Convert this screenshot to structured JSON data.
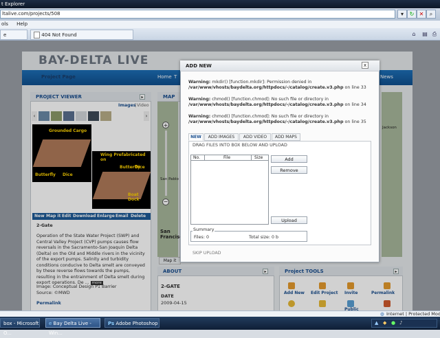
{
  "browser": {
    "title": "t Explorer",
    "address": "ltalive.com/projects/508",
    "menu": [
      "ols",
      "Help"
    ],
    "tabs": [
      "e",
      "404 Not Found"
    ]
  },
  "site": {
    "logo": "BAY-DELTA LIVE",
    "nav": [
      "Project Page",
      "Home",
      "T",
      "News"
    ],
    "viewer": {
      "header": "PROJECT VIEWER",
      "images_link": "Images",
      "video_link": "Video",
      "slide_labels": [
        "Grounded Cargo",
        "Wing Prefabricated on",
        "Butterfly",
        "Dice",
        "Boat Dock",
        "Butterfly",
        "Dice"
      ],
      "actions": [
        "New",
        "Map it",
        "Edit",
        "Download",
        "Enlarge",
        "Email",
        "Delete"
      ],
      "caption_title": "2-Gate",
      "caption": "Operation of the State Water Project (SWP) and Central Valley Project (CVP) pumps causes flow reversals in the Sacramento-San Joaquin Delta (Delta) on the Old and Middle rivers in the vicinity of the export pumps. Salinity and turbidity conditions conducive to Delta smelt are conveyed by these reverse flows towards the pumps, resulting in the entrainment of Delta smelt during export operations. De ...",
      "more": "more",
      "image_line": "Image: Conceptual Design P1 Barrier",
      "source_line": "Source: ©MWD",
      "permalink": "Permalink"
    },
    "map": {
      "header": "MAP",
      "labels": [
        "San Pablo B",
        "San Francisco",
        "Jackson"
      ],
      "map_it": "Map it"
    },
    "about": {
      "header": "ABOUT",
      "name": "2-GATE",
      "date_label": "DATE",
      "date": "2009-04-15"
    },
    "tools": {
      "header": "Project TOOLS",
      "items": [
        "Add New",
        "Edit Project",
        "Invite",
        "Permalink",
        "Public"
      ]
    }
  },
  "dialog": {
    "title": "ADD NEW",
    "close": "x",
    "warnings": [
      {
        "label": "Warning:",
        "text": "mkdir() [function.mkdir]: Permission denied in",
        "path": "/var/www/vhosts/baydelta.org/httpdocs/-/catalog/create.v3.php",
        "line": "on line 33"
      },
      {
        "label": "Warning:",
        "text": "chmod() [function.chmod]: No such file or directory in",
        "path": "/var/www/vhosts/baydelta.org/httpdocs/-/catalog/create.v3.php",
        "line": "on line 34"
      },
      {
        "label": "Warning:",
        "text": "chmod() [function.chmod]: No such file or directory in",
        "path": "/var/www/vhosts/baydelta.org/httpdocs/-/catalog/create.v3.php",
        "line": "on line 35"
      }
    ],
    "tabs": [
      "NEW",
      "ADD IMAGES",
      "ADD VIDEO",
      "ADD MAPS"
    ],
    "drag_text": "DRAG FILES INTO BOX BELOW AND UPLOAD",
    "columns": [
      "No.",
      "File",
      "Size"
    ],
    "add": "Add",
    "remove": "Remove",
    "upload": "Upload",
    "summary_label": "Summary",
    "files": "Files: 0",
    "total": "Total size: 0 b",
    "skip": "SKIP UPLOAD"
  },
  "statusbar": {
    "zone": "Internet | Protected Mode: O"
  },
  "taskbar": [
    "box - Microsoft O...",
    "Bay Delta Live - Win...",
    "Adobe Photoshop"
  ]
}
